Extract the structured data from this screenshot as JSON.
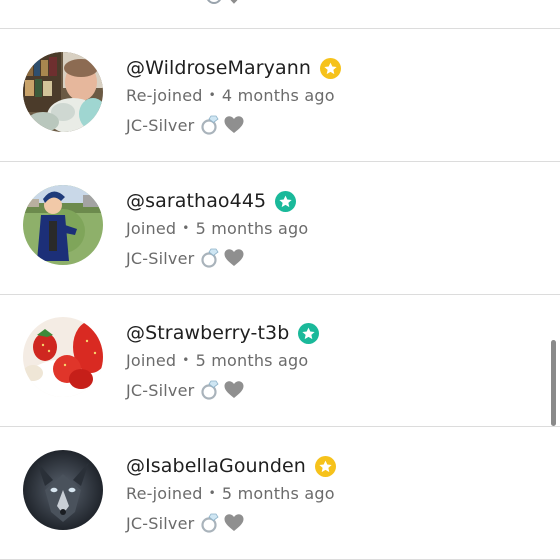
{
  "members": [
    {
      "username": "@WildroseMaryann",
      "status": "Re-joined",
      "time": "4 months ago",
      "role": "JC-Silver",
      "badge_color": "#f6c21b",
      "role_icons": [
        "ring-icon",
        "silver-heart-icon"
      ]
    },
    {
      "username": "@sarathao445",
      "status": "Joined",
      "time": "5 months ago",
      "role": "JC-Silver",
      "badge_color": "#1ab99a",
      "role_icons": [
        "ring-icon",
        "silver-heart-icon"
      ]
    },
    {
      "username": "@Strawberry-t3b",
      "status": "Joined",
      "time": "5 months ago",
      "role": "JC-Silver",
      "badge_color": "#1ab99a",
      "role_icons": [
        "ring-icon",
        "silver-heart-icon"
      ]
    },
    {
      "username": "@IsabellaGounden",
      "status": "Re-joined",
      "time": "5 months ago",
      "role": "JC-Silver",
      "badge_color": "#f6c21b",
      "role_icons": [
        "ring-icon",
        "silver-heart-icon"
      ]
    }
  ],
  "separator": "•",
  "colors": {
    "gold_badge": "#f6c21b",
    "teal_badge": "#1ab99a",
    "text_primary": "#1f1f1f",
    "text_secondary": "#6b6b6b",
    "divider": "#dcdcdc"
  }
}
